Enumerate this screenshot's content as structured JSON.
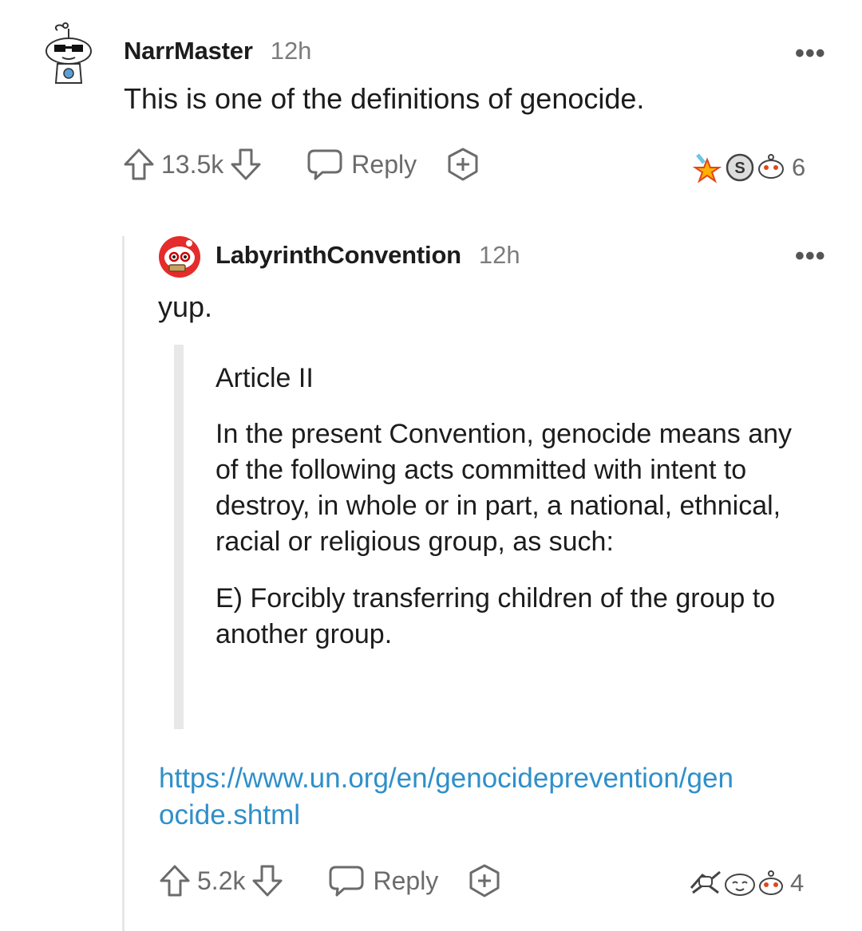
{
  "comments": [
    {
      "username": "NarrMaster",
      "time": "12h",
      "body": "This is one of the definitions of genocide.",
      "score": "13.5k",
      "reply_label": "Reply",
      "award_count": "6",
      "more_label": "•••"
    },
    {
      "username": "LabyrinthConvention",
      "time": "12h",
      "body": "yup.",
      "quote": {
        "title": "Article II",
        "paragraph": "In the present Convention, genocide means any of the following acts committed with intent to destroy, in whole or in part, a national, ethnical, racial or religious group, as such:",
        "item": "E) Forcibly transferring children of the group to another group."
      },
      "link": {
        "line1": "https://www.un.org/en/genocideprevention/gen",
        "line2": "ocide.shtml"
      },
      "score": "5.2k",
      "reply_label": "Reply",
      "award_count": "4",
      "more_label": "•••"
    }
  ],
  "icons": {
    "upvote": "arrow-up-outline",
    "downvote": "arrow-down-outline",
    "reply": "speech-bubble-outline",
    "award": "plus-hexagon-outline"
  }
}
